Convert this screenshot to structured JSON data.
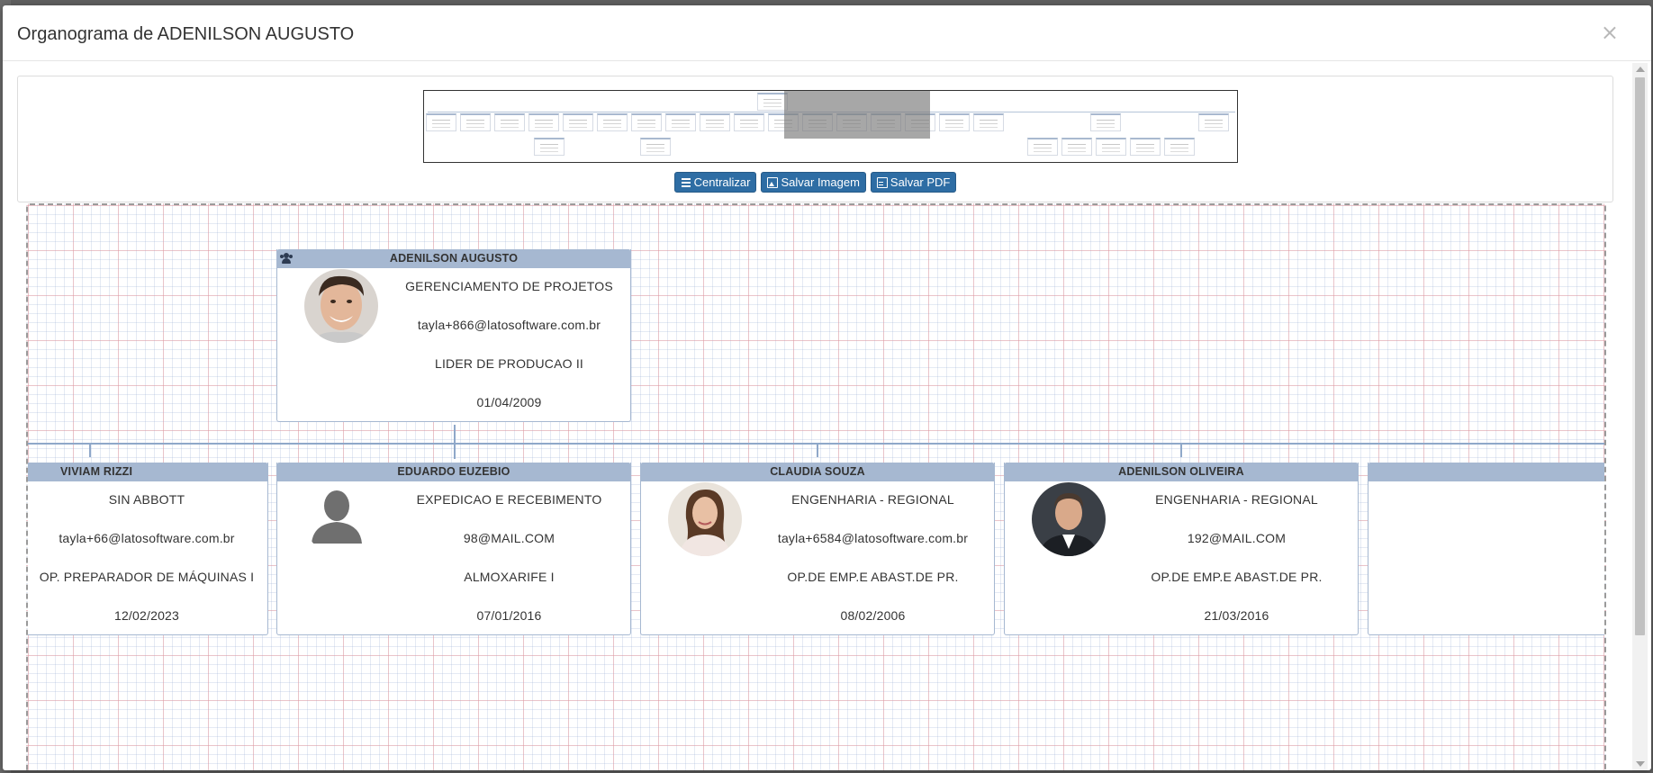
{
  "modal": {
    "title": "Organograma de ADENILSON AUGUSTO",
    "close_label": "×"
  },
  "toolbar": {
    "center_label": "Centralizar",
    "save_image_label": "Salvar Imagem",
    "save_pdf_label": "Salvar PDF"
  },
  "root": {
    "name": "ADENILSON AUGUSTO",
    "department": "GERENCIAMENTO DE PROJETOS",
    "email": "tayla+866@latosoftware.com.br",
    "role": "LIDER DE PRODUCAO II",
    "date": "01/04/2009",
    "photo": "male-photo"
  },
  "children": [
    {
      "name": "VIVIAM RIZZI",
      "department": "SIN ABBOTT",
      "email": "tayla+66@latosoftware.com.br",
      "role": "OP. PREPARADOR DE MÁQUINAS I",
      "date": "12/02/2023",
      "photo": "none"
    },
    {
      "name": "EDUARDO EUZEBIO",
      "department": "EXPEDICAO E RECEBIMENTO",
      "email": "98@MAIL.COM",
      "role": "ALMOXARIFE I",
      "date": "07/01/2016",
      "photo": "placeholder-silhouette"
    },
    {
      "name": "CLAUDIA SOUZA",
      "department": "ENGENHARIA - REGIONAL",
      "email": "tayla+6584@latosoftware.com.br",
      "role": "OP.DE EMP.E ABAST.DE PR.",
      "date": "08/02/2006",
      "photo": "female-photo"
    },
    {
      "name": "ADENILSON OLIVEIRA",
      "department": "ENGENHARIA - REGIONAL",
      "email": "192@MAIL.COM",
      "role": "OP.DE EMP.E ABAST.DE PR.",
      "date": "21/03/2016",
      "photo": "male-suit-photo"
    }
  ],
  "colors": {
    "card_header": "#a6b8d1",
    "button": "#2e6da4",
    "connector": "#8fa8c9"
  }
}
